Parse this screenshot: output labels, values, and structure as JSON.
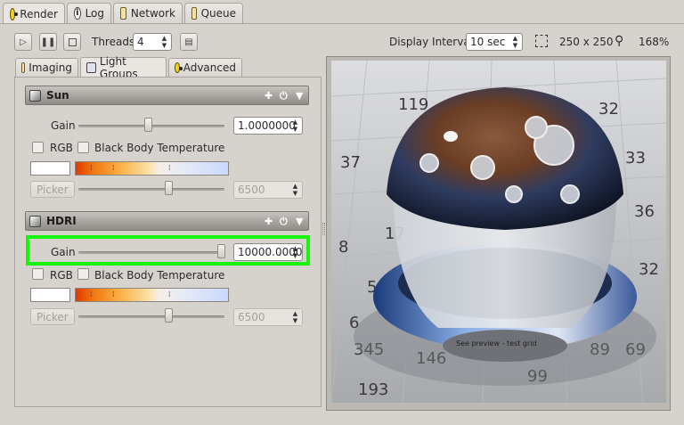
{
  "tabs": [
    {
      "label": "Render",
      "icon": "radiation-icon",
      "active": true
    },
    {
      "label": "Log",
      "icon": "info-icon"
    },
    {
      "label": "Network",
      "icon": "network-icon"
    },
    {
      "label": "Queue",
      "icon": "queue-icon"
    }
  ],
  "toolbar": {
    "threads_label": "Threads:",
    "threads_value": "4",
    "display_interval_label": "Display Interval:",
    "display_interval_value": "10 sec",
    "resolution": "250 x 250",
    "zoom": "168%"
  },
  "subtabs": [
    {
      "label": "Imaging"
    },
    {
      "label": "Light Groups",
      "active": true
    },
    {
      "label": "Advanced"
    }
  ],
  "groups": [
    {
      "name": "Sun",
      "gain_label": "Gain",
      "gain_value": "1.0000000",
      "gain_slider_level": 0.48,
      "rgb_label": "RGB",
      "bbt_label": "Black Body Temperature",
      "picker_label": "Picker",
      "temperature_value": "6500",
      "temperature_slider_level": 0.62
    },
    {
      "name": "HDRI",
      "gain_label": "Gain",
      "gain_value": "10000.0000",
      "gain_slider_level": 0.98,
      "rgb_label": "RGB",
      "bbt_label": "Black Body Temperature",
      "picker_label": "Picker",
      "temperature_value": "6500",
      "temperature_slider_level": 0.62
    }
  ],
  "render_numbers": [
    "37",
    "8",
    "6",
    "119",
    "32",
    "33",
    "36",
    "32",
    "89",
    "99",
    "53",
    "17",
    "345",
    "146",
    "69",
    "193"
  ],
  "render_caption": "See preview - test grid",
  "colors": {
    "highlight": "#16f50c",
    "header_gradient_top": "#c7c3be",
    "header_gradient_bottom": "#8f8b86",
    "window_bg": "#d6d2cd"
  }
}
